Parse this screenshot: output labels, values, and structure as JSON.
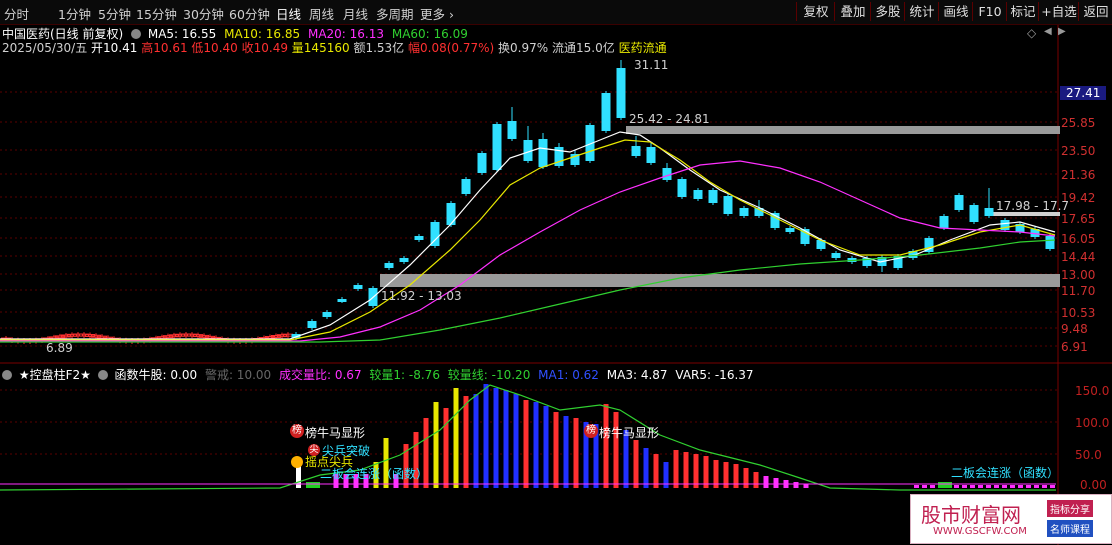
{
  "toolbar": {
    "tabs": [
      "分时",
      "1分钟",
      "5分钟",
      "15分钟",
      "30分钟",
      "60分钟",
      "日线",
      "周线",
      "月线",
      "多周期",
      "更多 ›"
    ],
    "active_tab": "日线",
    "right_buttons": [
      "复权",
      "叠加",
      "多股",
      "统计",
      "画线",
      "F10",
      "标记",
      "+自选",
      "返回"
    ]
  },
  "header": {
    "title": "中国医药(日线 前复权)",
    "ma5": "MA5: 16.55",
    "ma10": "MA10: 16.85",
    "ma20": "MA20: 16.13",
    "ma60": "MA60: 16.09",
    "date": "2025/05/30/五",
    "open": "开10.41",
    "high": "高10.61",
    "low": "低10.40",
    "close": "收10.49",
    "volume": "量145160",
    "amount": "额1.53亿",
    "change": "幅0.08(0.77%)",
    "turnover": "换0.97%",
    "float": "流通15.0亿",
    "sector": "医药流通",
    "colors": {
      "ma5": "#ffffff",
      "ma10": "#e8e800",
      "ma20": "#ff30ff",
      "ma60": "#30d030",
      "up": "#ff3030",
      "down": "#30e0ff"
    }
  },
  "price_axis": {
    "labels": [
      "27.41",
      "25.85",
      "23.50",
      "21.36",
      "19.42",
      "17.65",
      "16.05",
      "14.44",
      "13.00",
      "11.70",
      "10.53",
      "9.48",
      "6.91"
    ],
    "current_price": "27.41",
    "current_price_bg": "#1a1a80"
  },
  "annotations": {
    "peak": "31.11",
    "zone_high": "25.42 - 24.81",
    "zone_low": "11.92 - 13.03",
    "zone_right": "17.98 - 17.7",
    "min_price": "6.89"
  },
  "indicator": {
    "name": "★控盘柱F2★",
    "func": "函数牛股: 0.00",
    "alert": "警戒: 10.00",
    "vol_ratio": "成交量比: 0.67",
    "line1": "较量1: -8.76",
    "line2": "较量线: -10.20",
    "ma1": "MA1: 0.62",
    "ma3": "MA3: 4.87",
    "var5": "VAR5: -16.37",
    "axis": [
      "150.0",
      "100.0",
      "50.0",
      "0.00"
    ],
    "signals": {
      "bull1": "榜牛马显形",
      "spike": "尖兵突破",
      "lead": "摇点尖兵",
      "board": "二板会连涨（函数）",
      "bull2": "榜牛马显形",
      "board2": "二板会连涨（函数）",
      "bull1_marker": "榜",
      "bull2_marker": "榜",
      "spike_marker": "尖"
    }
  },
  "watermark": {
    "site": "股市财富网",
    "url": "WWW.GSCFW.COM",
    "tag1": "指标分享",
    "tag2": "名师课程"
  },
  "icons": [
    "circle-collapse-icon",
    "diamond-icon",
    "arrow-left-icon",
    "arrow-right-icon",
    "settings-icon"
  ]
}
